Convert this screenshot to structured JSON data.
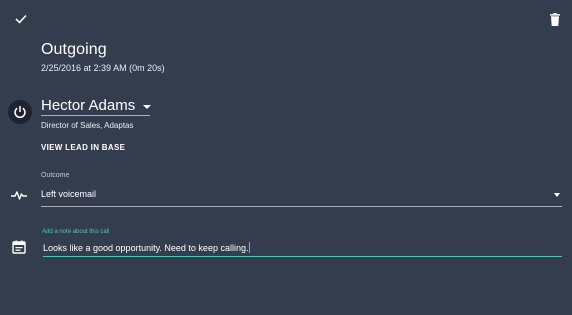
{
  "call": {
    "direction": "Outgoing",
    "datetime": "2/25/2016 at 2:39 AM (0m 20s)"
  },
  "contact": {
    "name": "Hector Adams",
    "title": "Director of Sales, Adaptas",
    "view_link": "VIEW LEAD IN BASE"
  },
  "outcome": {
    "label": "Outcome",
    "value": "Left voicemail"
  },
  "note": {
    "label": "Add a note about this call",
    "value": "Looks like a good opportunity. Need to keep calling."
  },
  "icons": {
    "check": "check-icon",
    "delete": "trash-icon",
    "avatar": "power-icon",
    "outcome": "pulse-icon",
    "note": "calendar-icon"
  },
  "colors": {
    "background": "#343d4e",
    "accent": "#4fc9a9",
    "avatar_bg": "#1d2330"
  }
}
